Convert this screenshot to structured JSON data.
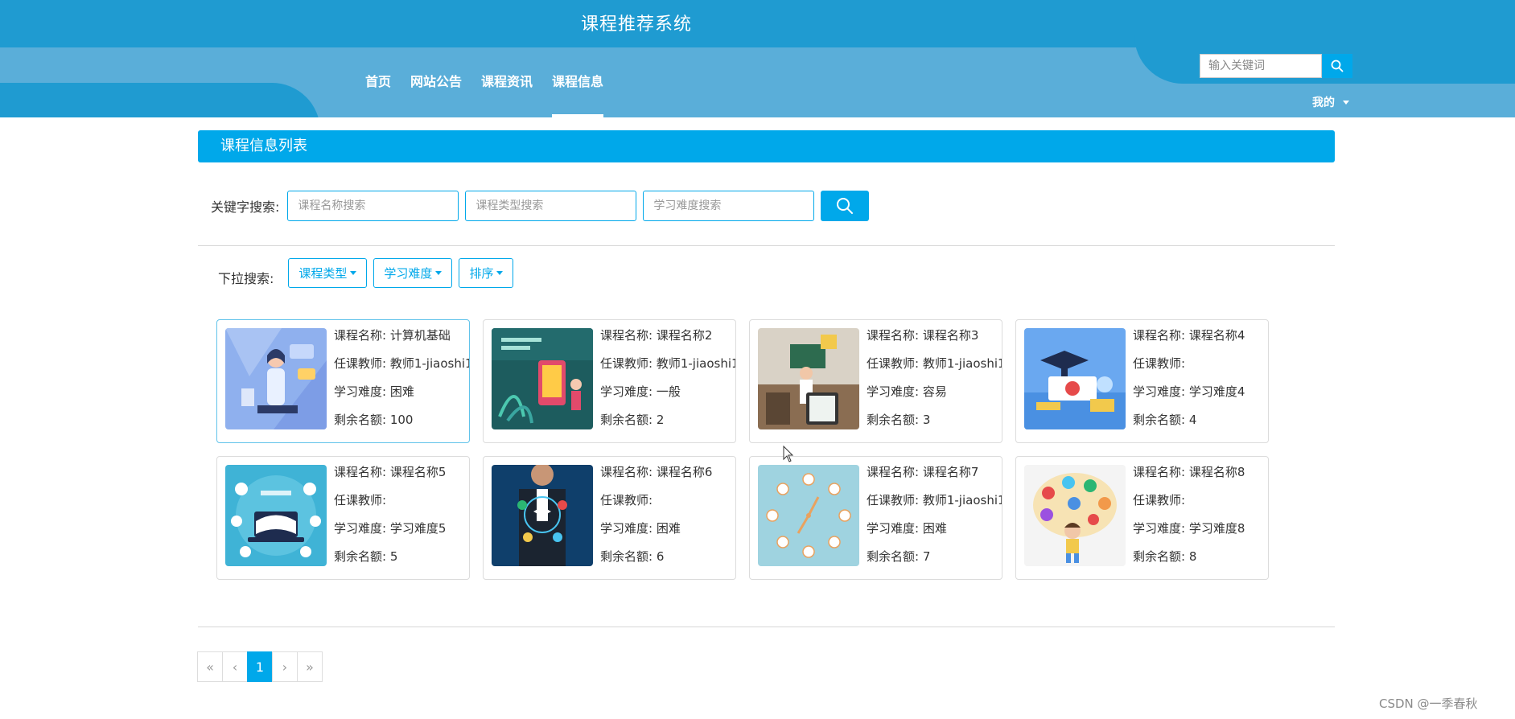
{
  "site": {
    "title": "课程推荐系统"
  },
  "nav": {
    "items": [
      {
        "label": "首页"
      },
      {
        "label": "网站公告"
      },
      {
        "label": "课程资讯"
      },
      {
        "label": "课程信息"
      }
    ],
    "active": "课程信息"
  },
  "top_search": {
    "placeholder": "输入关键词",
    "icon": "search-icon"
  },
  "user_menu": {
    "label": "我的"
  },
  "section": {
    "title": "课程信息列表"
  },
  "keyword_search": {
    "label": "关键字搜索:",
    "name_placeholder": "课程名称搜索",
    "type_placeholder": "课程类型搜索",
    "difficulty_placeholder": "学习难度搜索",
    "button_icon": "search-icon"
  },
  "dropdown_search": {
    "label": "下拉搜索:",
    "course_type": "课程类型",
    "difficulty": "学习难度",
    "sort": "排序"
  },
  "field_labels": {
    "name": "课程名称:",
    "teacher": "任课教师:",
    "difficulty": "学习难度:",
    "remaining": "剩余名额:"
  },
  "courses": [
    {
      "name": "计算机基础",
      "teacher": "教师1-jiaoshi1",
      "difficulty": "困难",
      "remaining": "100"
    },
    {
      "name": "课程名称2",
      "teacher": "教师1-jiaoshi1",
      "difficulty": "一般",
      "remaining": "2"
    },
    {
      "name": "课程名称3",
      "teacher": "教师1-jiaoshi1",
      "difficulty": "容易",
      "remaining": "3"
    },
    {
      "name": "课程名称4",
      "teacher": "",
      "difficulty": "学习难度4",
      "remaining": "4"
    },
    {
      "name": "课程名称5",
      "teacher": "",
      "difficulty": "学习难度5",
      "remaining": "5"
    },
    {
      "name": "课程名称6",
      "teacher": "",
      "difficulty": "困难",
      "remaining": "6"
    },
    {
      "name": "课程名称7",
      "teacher": "教师1-jiaoshi1",
      "difficulty": "困难",
      "remaining": "7"
    },
    {
      "name": "课程名称8",
      "teacher": "",
      "difficulty": "学习难度8",
      "remaining": "8"
    }
  ],
  "pagination": {
    "first": "«",
    "prev": "‹",
    "current": "1",
    "next": "›",
    "last": "»"
  },
  "watermark": "CSDN @一季春秋",
  "colors": {
    "header": "#1f9bd1",
    "header_light": "#5aaed9",
    "accent": "#00a8ea"
  }
}
